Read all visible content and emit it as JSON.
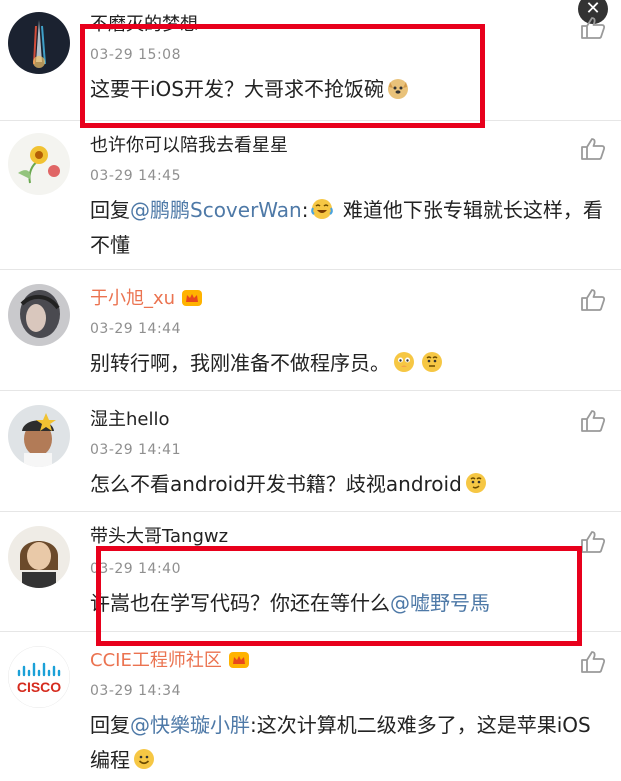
{
  "comments": [
    {
      "name": "不磨灭的梦想",
      "time": "03-29 15:08",
      "text_before": "这要干iOS开发？大哥求不抢饭碗",
      "mention": "",
      "text_after": "",
      "emoji": "doge-emoji"
    },
    {
      "name": "也许你可以陪我去看星星",
      "time": "03-29 14:45",
      "text_before": "回复",
      "mention": "@鹏鹏ScoverWan",
      "text_after": "难道他下张专辑就长这样，看不懂",
      "emoji": "laugh-cry-emoji"
    },
    {
      "name": "于小旭_xu",
      "time": "03-29 14:44",
      "text_before": "别转行啊，我刚准备不做程序员。",
      "mention": "",
      "text_after": "",
      "emoji": "pray-emoji"
    },
    {
      "name": "湿主hello",
      "time": "03-29 14:41",
      "text_before": "怎么不看android开发书籍？歧视android",
      "mention": "",
      "text_after": "",
      "emoji": "thinking-emoji"
    },
    {
      "name": "带头大哥Tangwz",
      "time": "03-29 14:40",
      "text_before": "许嵩也在学写代码？你还在等什么",
      "mention": "@嘘野号馬",
      "text_after": "",
      "emoji": ""
    },
    {
      "name": "CCIE工程师社区",
      "time": "03-29 14:34",
      "text_before": "回复",
      "mention": "@快樂璇小胖",
      "text_after": ":这次计算机二级难多了，这是苹果iOS编程",
      "emoji": "smile-emoji"
    }
  ],
  "logo_text": "CISCO",
  "colors": {
    "highlight": "#e8001c",
    "mention": "#4e79a7",
    "vip_name": "#eb7350",
    "time": "#8f8f8f"
  },
  "icons": {
    "like": "thumbs-up-icon",
    "close": "close-icon",
    "vip": "vip-crown-icon"
  }
}
